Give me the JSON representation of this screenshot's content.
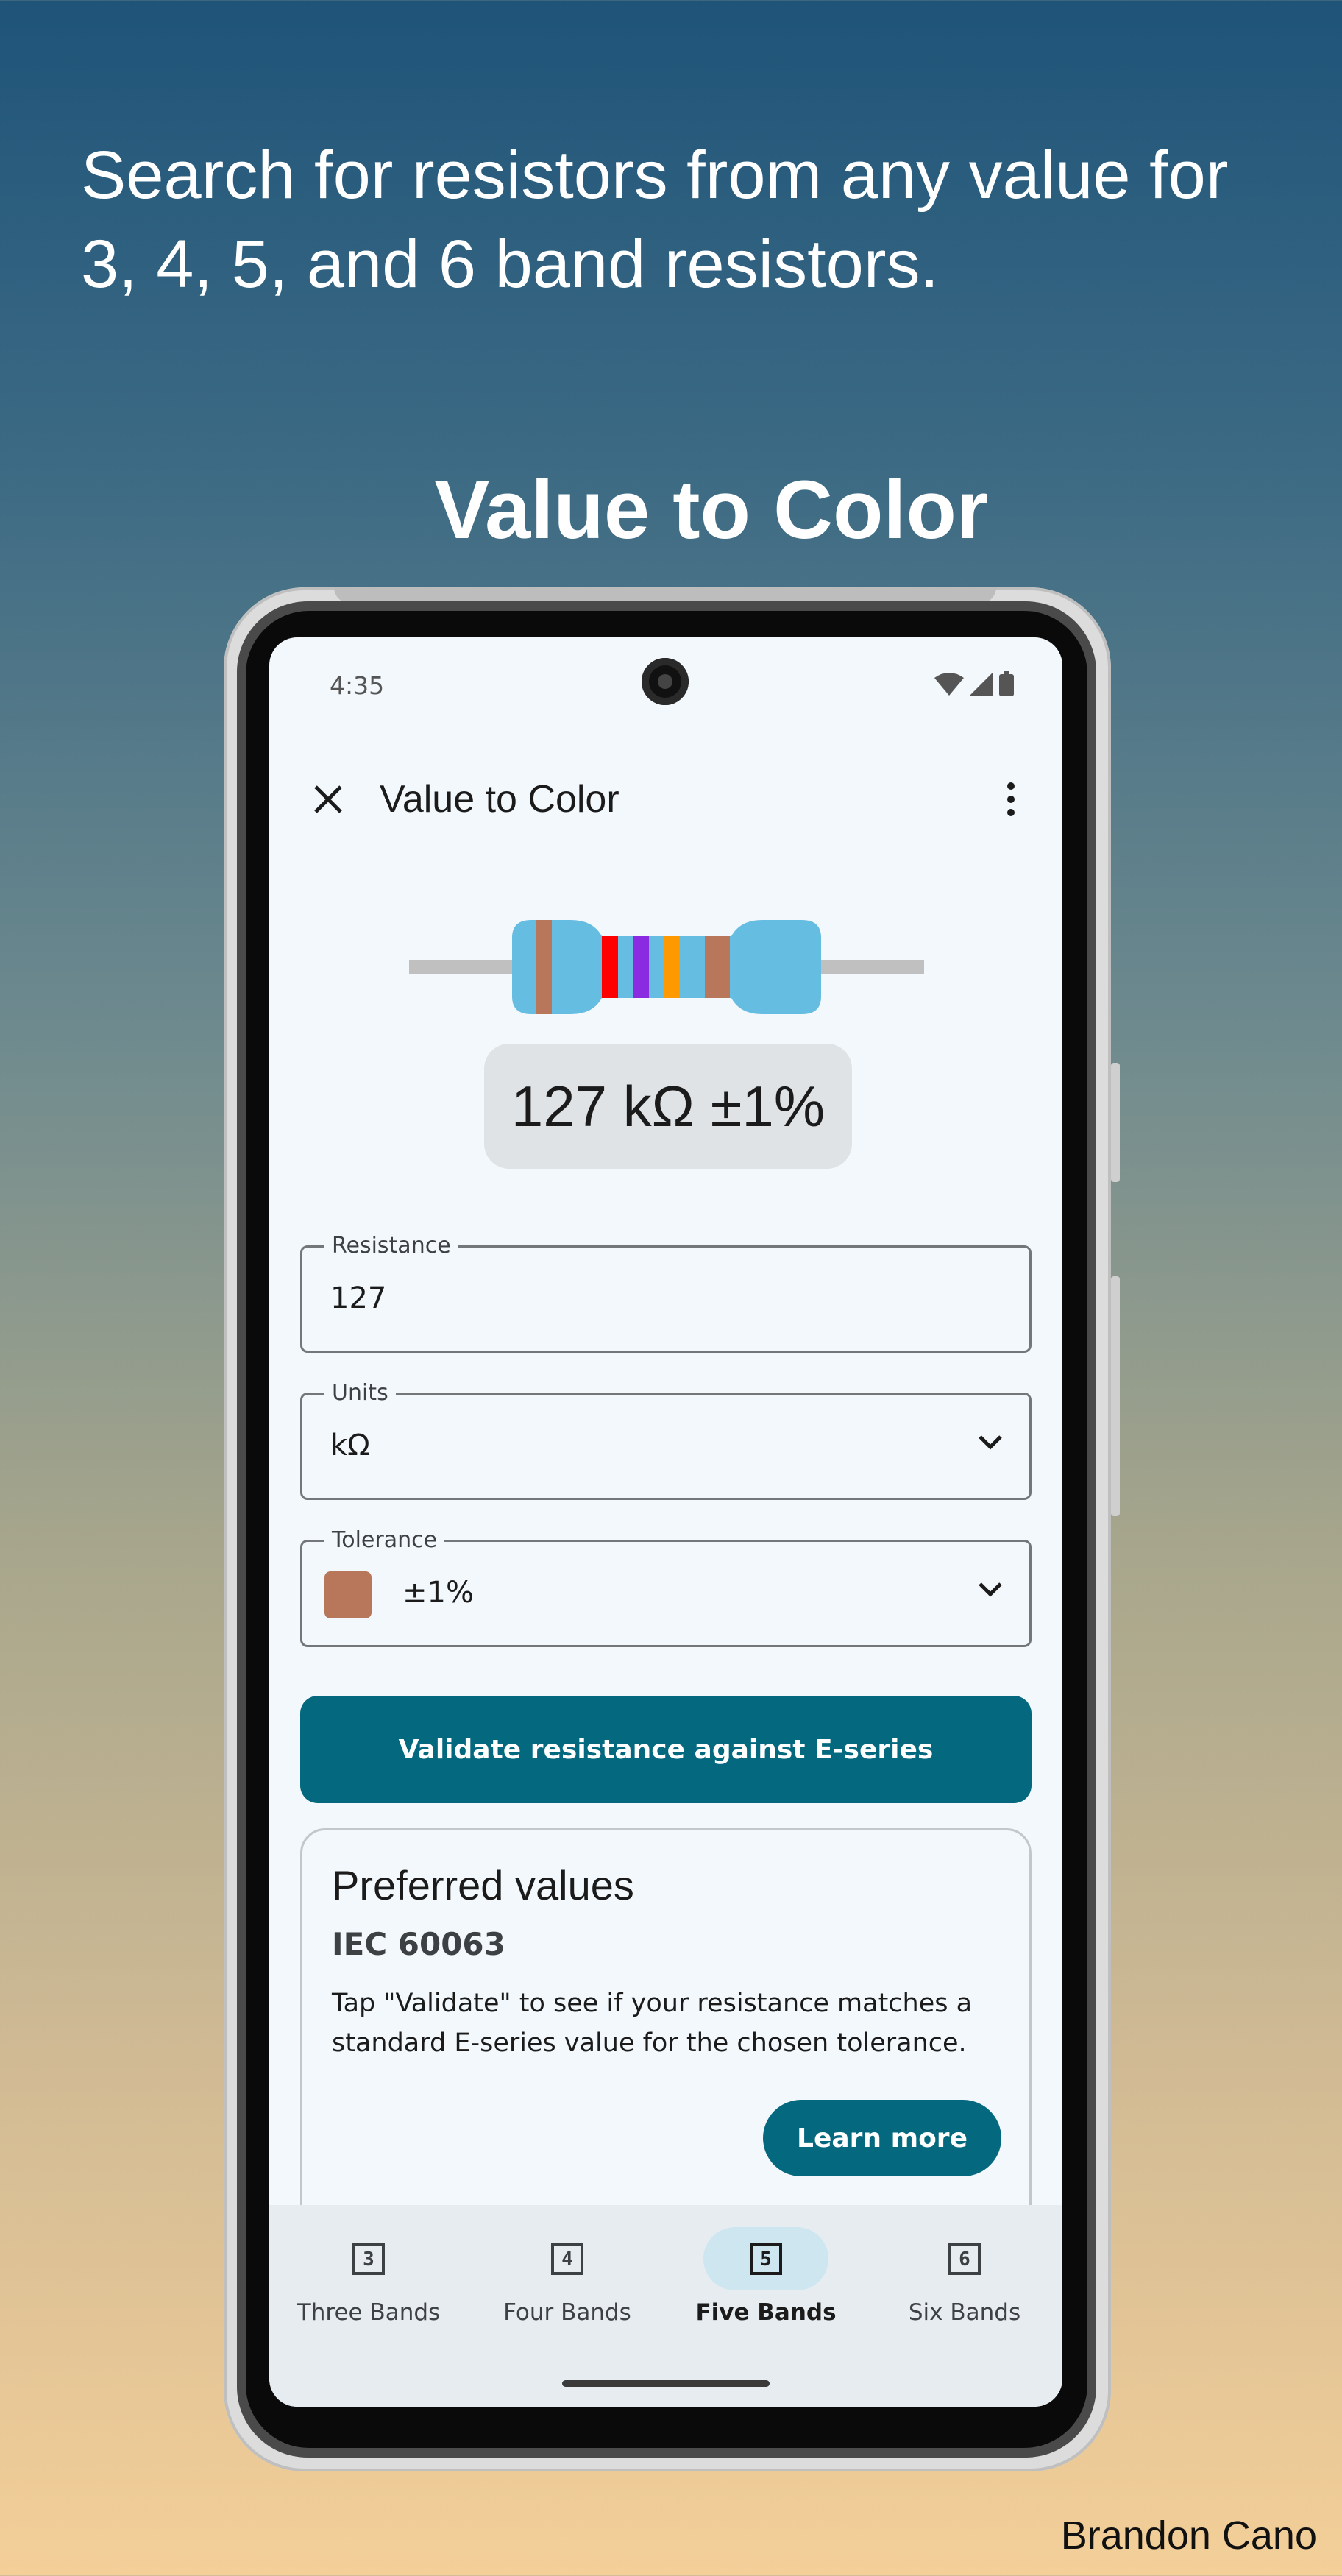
{
  "promo": {
    "heading_line1": "Search for resistors from any value for",
    "heading_line2": "3, 4, 5, and 6 band resistors.",
    "title": "Value to Color",
    "credit": "Brandon Cano"
  },
  "statusbar": {
    "time": "4:35"
  },
  "appbar": {
    "title": "Value to Color",
    "close_icon": "close-icon",
    "menu_icon": "more-vert-icon"
  },
  "resistor": {
    "body_color": "#66bde2",
    "lead_color": "#c0c0c0",
    "band_colors": [
      "#b8775a",
      "#ff0000",
      "#8a2be2",
      "#ff9900",
      "#b8775a"
    ]
  },
  "value_display": "127 kΩ ±1%",
  "form": {
    "resistance": {
      "label": "Resistance",
      "value": "127"
    },
    "units": {
      "label": "Units",
      "value": "kΩ"
    },
    "tolerance": {
      "label": "Tolerance",
      "value": "±1%",
      "swatch_color": "#b8775a"
    }
  },
  "validate_button": "Validate resistance against E-series",
  "card": {
    "title": "Preferred values",
    "subtitle": "IEC 60063",
    "body": "Tap \"Validate\" to see if your resistance matches a standard E-series value for the chosen tolerance.",
    "button": "Learn more"
  },
  "bottom_nav": {
    "items": [
      {
        "label": "Three Bands",
        "glyph": "3",
        "active": false
      },
      {
        "label": "Four Bands",
        "glyph": "4",
        "active": false
      },
      {
        "label": "Five Bands",
        "glyph": "5",
        "active": true
      },
      {
        "label": "Six Bands",
        "glyph": "6",
        "active": false
      }
    ]
  },
  "colors": {
    "accent": "#04687e",
    "screen_bg": "#f2f8fb"
  }
}
